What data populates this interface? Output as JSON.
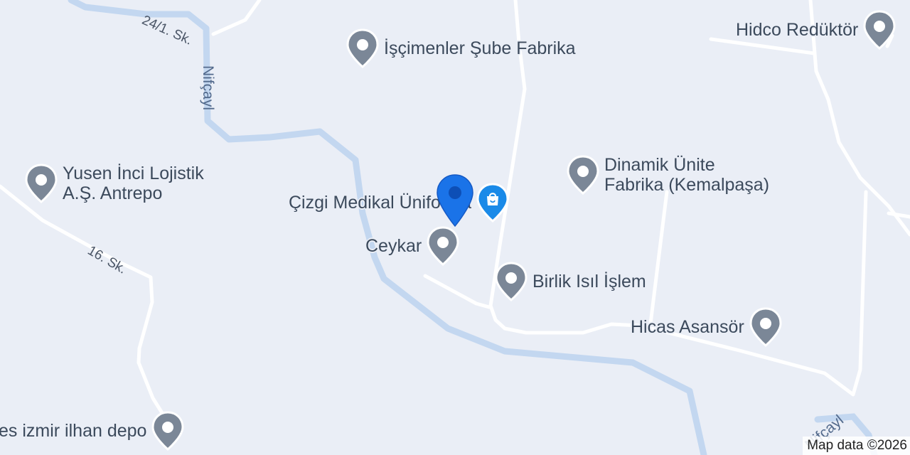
{
  "map": {
    "background_color": "#eaeef6",
    "water_color": "#c3d7f0",
    "road_color": "#ffffff",
    "attribution": "Map data ©2026"
  },
  "pois": [
    {
      "label": "İşçimenler Şube Fabrika",
      "icon": "generic-place-pin"
    },
    {
      "label": "Hidco Redüktör",
      "icon": "generic-place-pin"
    },
    {
      "label_line1": "Yusen İnci Lojistik",
      "label_line2": "A.Ş. Antrepo",
      "icon": "generic-place-pin"
    },
    {
      "label_line1": "Dinamik Ünite",
      "label_line2": "Fabrika (Kemalpaşa)",
      "icon": "generic-place-pin"
    },
    {
      "label": "Çizgi Medikal Üniforma",
      "icon": "shopping-bag-pin"
    },
    {
      "label": "Ceykar",
      "icon": "generic-place-pin"
    },
    {
      "label": "Birlik Isıl İşlem",
      "icon": "generic-place-pin"
    },
    {
      "label": "Hicas Asansör",
      "icon": "generic-place-pin"
    },
    {
      "label": "es izmir ilhan depo",
      "icon": "generic-place-pin"
    }
  ],
  "roads": {
    "r1": "24/1. Sk.",
    "r2": "16. Sk."
  },
  "waterways": {
    "w1": "Nifçayl",
    "w2": "Nifçayl"
  },
  "selected_marker": {
    "icon": "location-marker",
    "color": "#1a73e8"
  }
}
